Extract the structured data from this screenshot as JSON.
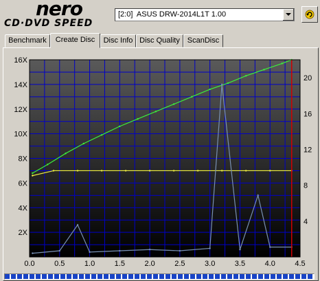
{
  "app": {
    "logo_top": "nero",
    "logo_bottom": "CD·DVD SPEED"
  },
  "drive": {
    "selected": "[2:0]  ASUS DRW-2014L1T 1.00"
  },
  "tabs": [
    {
      "label": "Benchmark"
    },
    {
      "label": "Create Disc"
    },
    {
      "label": "Disc Info"
    },
    {
      "label": "Disc Quality"
    },
    {
      "label": "ScanDisc"
    }
  ],
  "active_tab": "Create Disc",
  "progress": {
    "fraction": 1.0
  },
  "chart_data": {
    "type": "line",
    "y_left_ticks": [
      "2X",
      "4X",
      "6X",
      "8X",
      "10X",
      "12X",
      "14X",
      "16X"
    ],
    "y_right_ticks": [
      "4",
      "8",
      "12",
      "16",
      "20"
    ],
    "x_ticks": [
      "0.0",
      "0.5",
      "1.0",
      "1.5",
      "2.0",
      "2.5",
      "3.0",
      "3.5",
      "4.0",
      "4.5"
    ],
    "xlim": [
      0,
      4.5
    ],
    "ylim_left": [
      0,
      16
    ],
    "ylim_right": [
      0,
      22
    ],
    "grid": true,
    "background": "#000000",
    "grid_color": "#0000c8",
    "disc_end_marker_x": 4.36,
    "series": [
      {
        "color": "#3cf03c",
        "x": [
          0.05,
          0.3,
          0.6,
          0.9,
          1.2,
          1.5,
          1.8,
          2.1,
          2.4,
          2.7,
          3.0,
          3.3,
          3.6,
          3.9,
          4.2,
          4.36
        ],
        "y": [
          6.8,
          7.5,
          8.4,
          9.2,
          9.9,
          10.6,
          11.2,
          11.8,
          12.4,
          13.0,
          13.6,
          14.1,
          14.7,
          15.2,
          15.7,
          16.0
        ]
      },
      {
        "color": "#f0f040",
        "x": [
          0.05,
          0.4,
          0.8,
          1.2,
          1.6,
          2.0,
          2.4,
          2.8,
          3.2,
          3.6,
          4.0,
          4.36
        ],
        "y": [
          6.6,
          7.0,
          7.0,
          7.0,
          7.0,
          7.0,
          7.0,
          7.0,
          7.0,
          7.0,
          7.0,
          7.0
        ]
      },
      {
        "color": "#7890b4",
        "x": [
          0.05,
          0.5,
          0.8,
          1.0,
          1.5,
          2.0,
          2.5,
          3.0,
          3.2,
          3.5,
          3.8,
          4.0,
          4.36
        ],
        "y": [
          0.3,
          0.5,
          2.6,
          0.4,
          0.5,
          0.6,
          0.5,
          0.7,
          14.0,
          0.6,
          5.0,
          0.8,
          0.8
        ]
      }
    ]
  }
}
